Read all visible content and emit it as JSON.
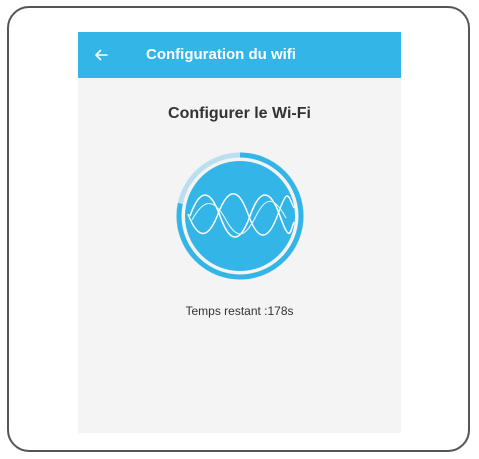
{
  "appbar": {
    "title": "Configuration du wifi",
    "back_icon": "arrow-left-icon",
    "color": "#34b5e8"
  },
  "main": {
    "title": "Configurer le Wi-Fi",
    "countdown_label": "Temps restant :178s",
    "animation_icon": "wifi-sound-wave-icon",
    "circle_color": "#34b5e8"
  }
}
